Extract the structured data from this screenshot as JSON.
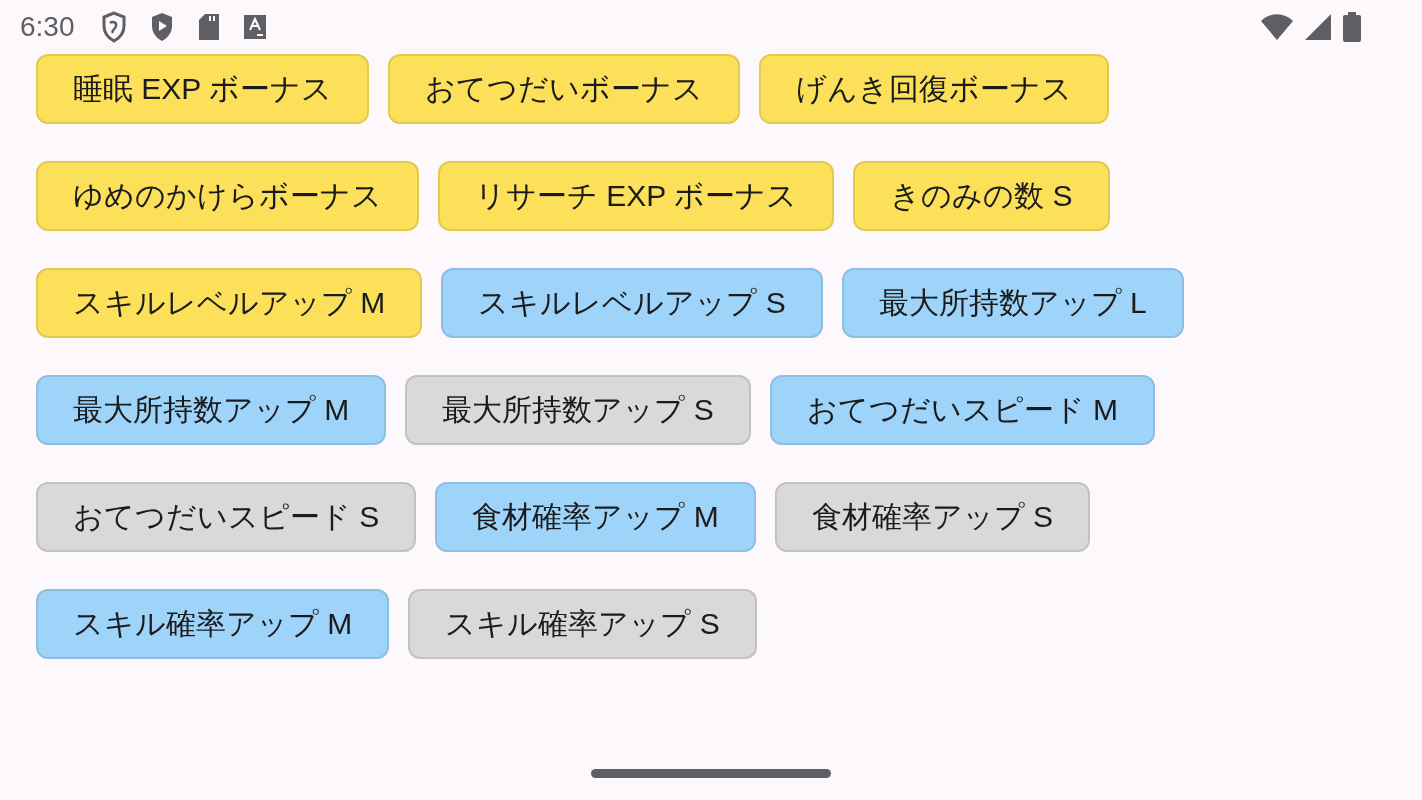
{
  "status_bar": {
    "time": "6:30"
  },
  "chip_rows": [
    [
      {
        "label": "睡眠 EXP ボーナス",
        "color": "#fde05a"
      },
      {
        "label": "おてつだいボーナス",
        "color": "#fde05a"
      },
      {
        "label": "げんき回復ボーナス",
        "color": "#fde05a"
      }
    ],
    [
      {
        "label": "ゆめのかけらボーナス",
        "color": "#fde05a"
      },
      {
        "label": "リサーチ EXP ボーナス",
        "color": "#fde05a"
      },
      {
        "label": "きのみの数 S",
        "color": "#fde05a"
      }
    ],
    [
      {
        "label": "スキルレベルアップ M",
        "color": "#fde05a"
      },
      {
        "label": "スキルレベルアップ S",
        "color": "#9fd4fa"
      },
      {
        "label": "最大所持数アップ L",
        "color": "#9fd4fa"
      }
    ],
    [
      {
        "label": "最大所持数アップ M",
        "color": "#9fd4fa"
      },
      {
        "label": "最大所持数アップ S",
        "color": "#d9d9d9"
      },
      {
        "label": "おてつだいスピード M",
        "color": "#9fd4fa"
      }
    ],
    [
      {
        "label": "おてつだいスピード S",
        "color": "#d9d9d9"
      },
      {
        "label": "食材確率アップ M",
        "color": "#9fd4fa"
      },
      {
        "label": "食材確率アップ S",
        "color": "#d9d9d9"
      }
    ],
    [
      {
        "label": "スキル確率アップ M",
        "color": "#9fd4fa"
      },
      {
        "label": "スキル確率アップ S",
        "color": "#d9d9d9"
      }
    ]
  ]
}
